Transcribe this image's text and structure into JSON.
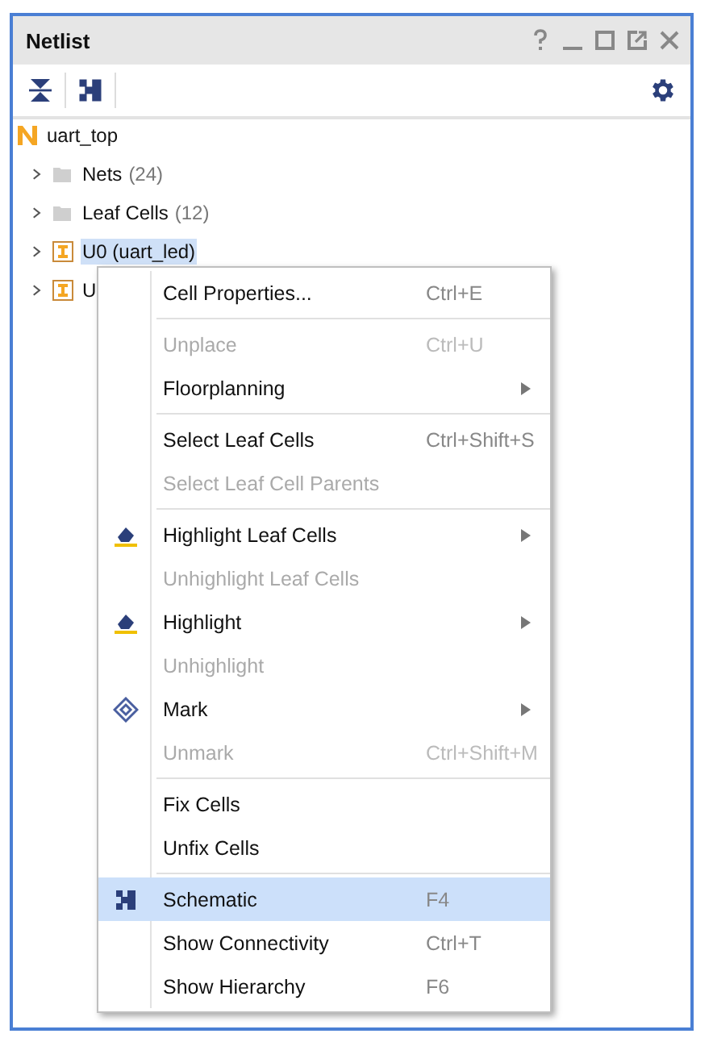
{
  "window": {
    "title": "Netlist"
  },
  "tree": {
    "label": "uart_top",
    "children": [
      {
        "label": "Nets",
        "count": "(24)",
        "kind": "folder",
        "selected": false
      },
      {
        "label": "Leaf Cells",
        "count": "(12)",
        "kind": "folder",
        "selected": false
      },
      {
        "label": "U0 (uart_led)",
        "kind": "cell",
        "selected": true
      },
      {
        "label": "U",
        "kind": "cell",
        "selected": false
      }
    ]
  },
  "context_menu": {
    "groups": [
      [
        {
          "label": "Cell Properties...",
          "shortcut": "Ctrl+E",
          "disabled": false,
          "submenu": false,
          "selected": false,
          "kind": "plain"
        }
      ],
      [
        {
          "label": "Unplace",
          "shortcut": "Ctrl+U",
          "disabled": true,
          "submenu": false,
          "selected": false,
          "kind": "plain"
        },
        {
          "label": "Floorplanning",
          "disabled": false,
          "submenu": true,
          "selected": false,
          "kind": "plain"
        }
      ],
      [
        {
          "label": "Select Leaf Cells",
          "shortcut": "Ctrl+Shift+S",
          "disabled": false,
          "submenu": false,
          "selected": false,
          "kind": "plain"
        },
        {
          "label": "Select Leaf Cell Parents",
          "disabled": true,
          "submenu": false,
          "selected": false,
          "kind": "plain"
        }
      ],
      [
        {
          "label": "Highlight Leaf Cells",
          "disabled": false,
          "submenu": true,
          "selected": false,
          "kind": "highlight"
        },
        {
          "label": "Unhighlight Leaf Cells",
          "disabled": true,
          "submenu": false,
          "selected": false,
          "kind": "plain"
        },
        {
          "label": "Highlight",
          "disabled": false,
          "submenu": true,
          "selected": false,
          "kind": "highlight"
        },
        {
          "label": "Unhighlight",
          "disabled": true,
          "submenu": false,
          "selected": false,
          "kind": "plain"
        },
        {
          "label": "Mark",
          "disabled": false,
          "submenu": true,
          "selected": false,
          "kind": "mark"
        },
        {
          "label": "Unmark",
          "shortcut": "Ctrl+Shift+M",
          "disabled": true,
          "submenu": false,
          "selected": false,
          "kind": "plain"
        }
      ],
      [
        {
          "label": "Fix Cells",
          "disabled": false,
          "submenu": false,
          "selected": false,
          "kind": "plain"
        },
        {
          "label": "Unfix Cells",
          "disabled": false,
          "submenu": false,
          "selected": false,
          "kind": "plain"
        }
      ],
      [
        {
          "label": "Schematic",
          "shortcut": "F4",
          "disabled": false,
          "submenu": false,
          "selected": true,
          "kind": "schematic"
        },
        {
          "label": "Show Connectivity",
          "shortcut": "Ctrl+T",
          "disabled": false,
          "submenu": false,
          "selected": false,
          "kind": "plain"
        },
        {
          "label": "Show Hierarchy",
          "shortcut": "F6",
          "disabled": false,
          "submenu": false,
          "selected": false,
          "kind": "plain"
        }
      ]
    ]
  }
}
